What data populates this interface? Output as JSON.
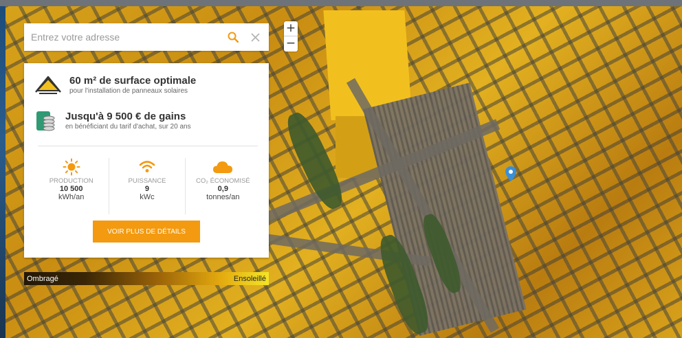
{
  "search": {
    "placeholder": "Entrez votre adresse",
    "search_icon": "search-icon",
    "clear_icon": "close-icon"
  },
  "zoom": {
    "in_label": "+",
    "out_label": "−"
  },
  "results": {
    "surface": {
      "title": "60 m² de surface optimale",
      "subtitle": "pour l'installation de panneaux solaires",
      "icon": "roof-icon"
    },
    "gains": {
      "title": "Jusqu'à 9 500 € de gains",
      "subtitle": "en bénéficiant du tarif d'achat, sur 20 ans",
      "icon": "coins-icon"
    },
    "stats": [
      {
        "icon": "sun-icon",
        "label": "PRODUCTION",
        "value": "10 500",
        "unit": "kWh/an"
      },
      {
        "icon": "wifi-icon",
        "label": "PUISSANCE",
        "value": "9",
        "unit": "kWc"
      },
      {
        "icon": "cloud-icon",
        "label": "CO₂ ÉCONOMISÉ",
        "value": "0,9",
        "unit": "tonnes/an"
      }
    ],
    "cta_label": "VOIR PLUS DE DÉTAILS"
  },
  "legend": {
    "left_label": "Ombragé",
    "right_label": "Ensoleillé"
  },
  "colors": {
    "accent": "#f39a10",
    "roof_icon": "#f2c01e",
    "coins_icon": "#2f9a73"
  }
}
